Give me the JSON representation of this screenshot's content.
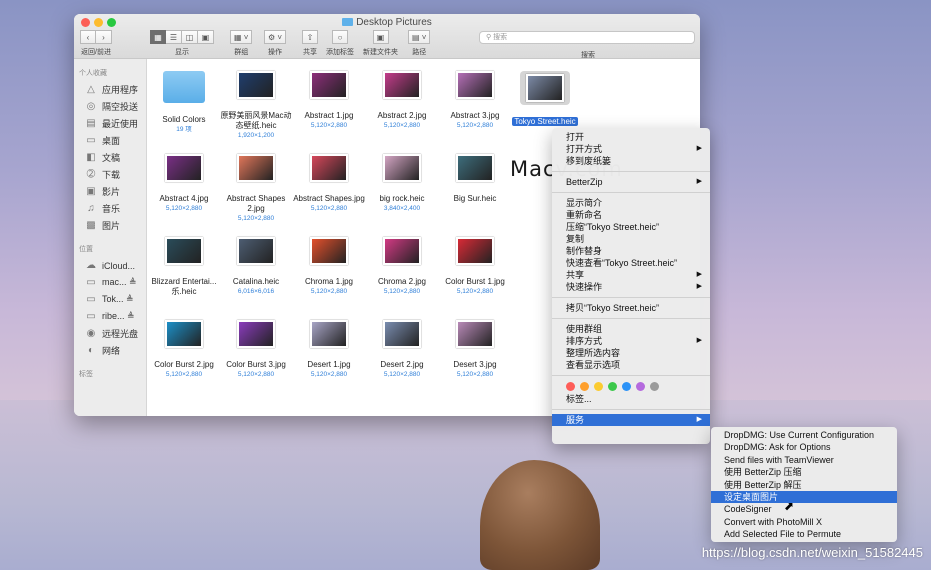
{
  "window": {
    "title": "Desktop Pictures",
    "toolbar": {
      "back_forward_label": "返回/前进",
      "view_label": "显示",
      "group_label": "群组",
      "action_label": "操作",
      "share_label": "共享",
      "tags_label": "添加标签",
      "new_folder_label": "新建文件夹",
      "path_label": "路径",
      "search_label": "搜索",
      "search_placeholder": "搜索"
    }
  },
  "sidebar": {
    "favorites_heading": "个人收藏",
    "favorites": [
      {
        "label": "应用程序",
        "icon": "apps-icon"
      },
      {
        "label": "隔空投送",
        "icon": "airdrop-icon"
      },
      {
        "label": "最近使用",
        "icon": "recents-icon"
      },
      {
        "label": "桌面",
        "icon": "desktop-icon"
      },
      {
        "label": "文稿",
        "icon": "documents-icon"
      },
      {
        "label": "下载",
        "icon": "downloads-icon"
      },
      {
        "label": "影片",
        "icon": "movies-icon"
      },
      {
        "label": "音乐",
        "icon": "music-icon"
      },
      {
        "label": "图片",
        "icon": "pictures-icon"
      }
    ],
    "locations_heading": "位置",
    "locations": [
      {
        "label": "iCloud...",
        "icon": "cloud-icon"
      },
      {
        "label": "mac...  ≜",
        "icon": "disk-icon"
      },
      {
        "label": "Tok...  ≜",
        "icon": "disk-icon"
      },
      {
        "label": "ribe...  ≜",
        "icon": "disk-icon"
      },
      {
        "label": "远程光盘",
        "icon": "remote-disc-icon"
      },
      {
        "label": "网络",
        "icon": "network-icon"
      }
    ],
    "tags_heading": "标签"
  },
  "files": [
    {
      "name": "Solid Colors",
      "dims": "19 项",
      "color": "#5aaee8",
      "folder": true
    },
    {
      "name": "原野美丽风景Mac动态壁纸.heic",
      "dims": "1,920×1,200",
      "color": "#1f3e6e"
    },
    {
      "name": "Abstract 1.jpg",
      "dims": "5,120×2,880",
      "color": "#8d2e7a"
    },
    {
      "name": "Abstract 2.jpg",
      "dims": "5,120×2,880",
      "color": "#c43c8b"
    },
    {
      "name": "Abstract 3.jpg",
      "dims": "5,120×2,880",
      "color": "#b56fb7"
    },
    {
      "name": "Tokyo Street.heic",
      "dims": "",
      "color": "#7c8aa6",
      "selected": true
    },
    {
      "name": "Abstract 4.jpg",
      "dims": "5,120×2,880",
      "color": "#7a2f86"
    },
    {
      "name": "Abstract Shapes 2.jpg",
      "dims": "5,120×2,880",
      "color": "#e0765a"
    },
    {
      "name": "Abstract Shapes.jpg",
      "dims": "5,120×2,880",
      "color": "#d6475b"
    },
    {
      "name": "big rock.heic",
      "dims": "3,840×2,400",
      "color": "#d3a5c3"
    },
    {
      "name": "Big Sur.heic",
      "dims": "",
      "color": "#3d6d7c"
    },
    {
      "name": "Blizzard Entertai...乐.heic",
      "dims": "",
      "color": "#2a4c5a"
    },
    {
      "name": "Catalina.heic",
      "dims": "6,016×6,016",
      "color": "#4d5d72"
    },
    {
      "name": "Chroma 1.jpg",
      "dims": "5,120×2,880",
      "color": "#e3502c"
    },
    {
      "name": "Chroma 2.jpg",
      "dims": "5,120×2,880",
      "color": "#d23a84"
    },
    {
      "name": "Color Burst 1.jpg",
      "dims": "5,120×2,880",
      "color": "#d82a36"
    },
    {
      "name": "Color Burst 2.jpg",
      "dims": "5,120×2,880",
      "color": "#1c90c8"
    },
    {
      "name": "Color Burst 3.jpg",
      "dims": "5,120×2,880",
      "color": "#8b3cbd"
    },
    {
      "name": "Desert 1.jpg",
      "dims": "5,120×2,880",
      "color": "#a8a5c6"
    },
    {
      "name": "Desert 2.jpg",
      "dims": "5,120×2,880",
      "color": "#7a8db0"
    },
    {
      "name": "Desert 3.jpg",
      "dims": "5,120×2,880",
      "color": "#b98ab8"
    }
  ],
  "context_menu": {
    "items": [
      {
        "label": "打开",
        "arrow": false
      },
      {
        "label": "打开方式",
        "arrow": true
      },
      {
        "label": "移到废纸篓",
        "arrow": false
      },
      {
        "sep": true
      },
      {
        "label": "BetterZip",
        "arrow": true
      },
      {
        "sep": true
      },
      {
        "label": "显示简介",
        "arrow": false
      },
      {
        "label": "重新命名",
        "arrow": false
      },
      {
        "label": "压缩“Tokyo Street.heic”",
        "arrow": false
      },
      {
        "label": "复制",
        "arrow": false
      },
      {
        "label": "制作替身",
        "arrow": false
      },
      {
        "label": "快速查看“Tokyo Street.heic”",
        "arrow": false
      },
      {
        "label": "共享",
        "arrow": true
      },
      {
        "label": "快速操作",
        "arrow": true
      },
      {
        "sep": true
      },
      {
        "label": "拷贝“Tokyo Street.heic”",
        "arrow": false
      },
      {
        "sep": true
      },
      {
        "label": "使用群组",
        "arrow": false
      },
      {
        "label": "排序方式",
        "arrow": true
      },
      {
        "label": "整理所选内容",
        "arrow": false
      },
      {
        "label": "查看显示选项",
        "arrow": false
      },
      {
        "sep": true
      },
      {
        "dots": true
      },
      {
        "label": "标签...",
        "arrow": false
      },
      {
        "sep": true
      },
      {
        "label": "服务",
        "arrow": true,
        "highlighted": true
      }
    ],
    "tag_colors": [
      "#fe5d58",
      "#fe9f2c",
      "#fbcb30",
      "#3cc84b",
      "#2c92f7",
      "#b56ade",
      "#9b9b9b"
    ]
  },
  "services_submenu": {
    "items": [
      {
        "label": "DropDMG: Use Current Configuration"
      },
      {
        "label": "DropDMG: Ask for Options"
      },
      {
        "label": "Send files with TeamViewer"
      },
      {
        "label": "使用 BetterZip 压缩"
      },
      {
        "label": "使用 BetterZip 解压"
      },
      {
        "label": "设定桌面图片",
        "highlighted": true
      },
      {
        "label": "CodeSigner"
      },
      {
        "label": "Convert with PhotoMill X"
      },
      {
        "label": "Add Selected File to Permute"
      }
    ]
  },
  "watermarks": {
    "macv": "Macv.com",
    "csdn": "https://blog.csdn.net/weixin_51582445"
  }
}
